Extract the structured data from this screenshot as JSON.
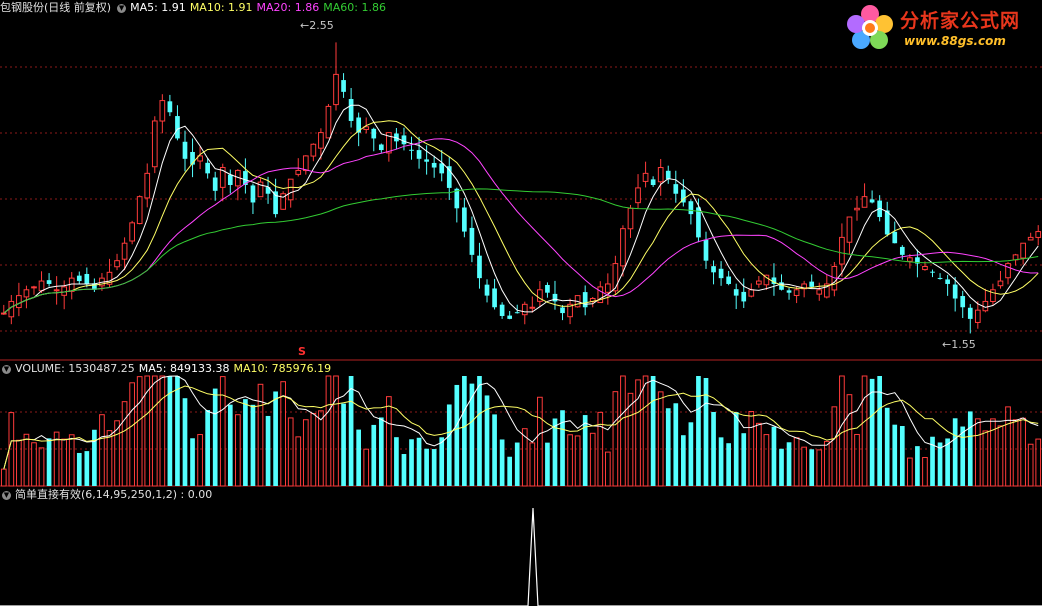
{
  "legend_price": {
    "title": "包钢股份(日线 前复权)",
    "ma5": "MA5: 1.91",
    "ma10": "MA10: 1.91",
    "ma20": "MA20: 1.86",
    "ma60": "MA60: 1.86"
  },
  "legend_volume": {
    "volume": "VOLUME: 1530487.25",
    "ma5": "MA5: 849133.38",
    "ma10": "MA10: 785976.19"
  },
  "legend_indicator": {
    "label": "简单直接有效(6,14,95,250,1,2) : 0.00"
  },
  "annotations": {
    "high": "2.55",
    "low": "1.55",
    "signal": "S"
  },
  "watermark": {
    "title": "分析家公式网",
    "url": "www.88gs.com"
  },
  "colors": {
    "up": "#ff3b3b",
    "down": "#54ffff",
    "ma5": "#ffffff",
    "ma10": "#ffff66",
    "ma20": "#ff44ff",
    "ma60": "#33cc33",
    "grid": "#8b1a1a",
    "indicator": "#ffffff"
  },
  "chart_data": {
    "type": "candlestick",
    "price_high": 2.55,
    "price_low": 1.55,
    "close": [
      1.62,
      1.66,
      1.68,
      1.7,
      1.71,
      1.73,
      1.72,
      1.7,
      1.71,
      1.74,
      1.73,
      1.72,
      1.7,
      1.74,
      1.76,
      1.8,
      1.86,
      1.93,
      2.02,
      2.1,
      2.28,
      2.35,
      2.31,
      2.22,
      2.15,
      2.13,
      2.16,
      2.1,
      2.04,
      2.12,
      2.06,
      2.11,
      2.06,
      2.0,
      2.07,
      2.03,
      1.96,
      2.03,
      2.08,
      2.11,
      2.16,
      2.2,
      2.24,
      2.33,
      2.44,
      2.38,
      2.28,
      2.24,
      2.26,
      2.22,
      2.18,
      2.24,
      2.21,
      2.2,
      2.18,
      2.15,
      2.14,
      2.12,
      2.1,
      2.05,
      1.98,
      1.9,
      1.82,
      1.74,
      1.68,
      1.64,
      1.61,
      1.6,
      1.62,
      1.65,
      1.64,
      1.7,
      1.69,
      1.66,
      1.62,
      1.65,
      1.68,
      1.64,
      1.67,
      1.71,
      1.72,
      1.79,
      1.91,
      1.98,
      2.05,
      2.1,
      2.06,
      2.12,
      2.08,
      2.03,
      2.0,
      1.96,
      1.88,
      1.8,
      1.76,
      1.74,
      1.72,
      1.68,
      1.66,
      1.7,
      1.73,
      1.75,
      1.72,
      1.7,
      1.69,
      1.7,
      1.72,
      1.71,
      1.7,
      1.72,
      1.78,
      1.88,
      1.95,
      1.98,
      2.02,
      2.0,
      1.95,
      1.89,
      1.86,
      1.82,
      1.81,
      1.79,
      1.78,
      1.76,
      1.74,
      1.72,
      1.67,
      1.64,
      1.6,
      1.63,
      1.66,
      1.7,
      1.73,
      1.79,
      1.82,
      1.86,
      1.88,
      1.9
    ]
  }
}
